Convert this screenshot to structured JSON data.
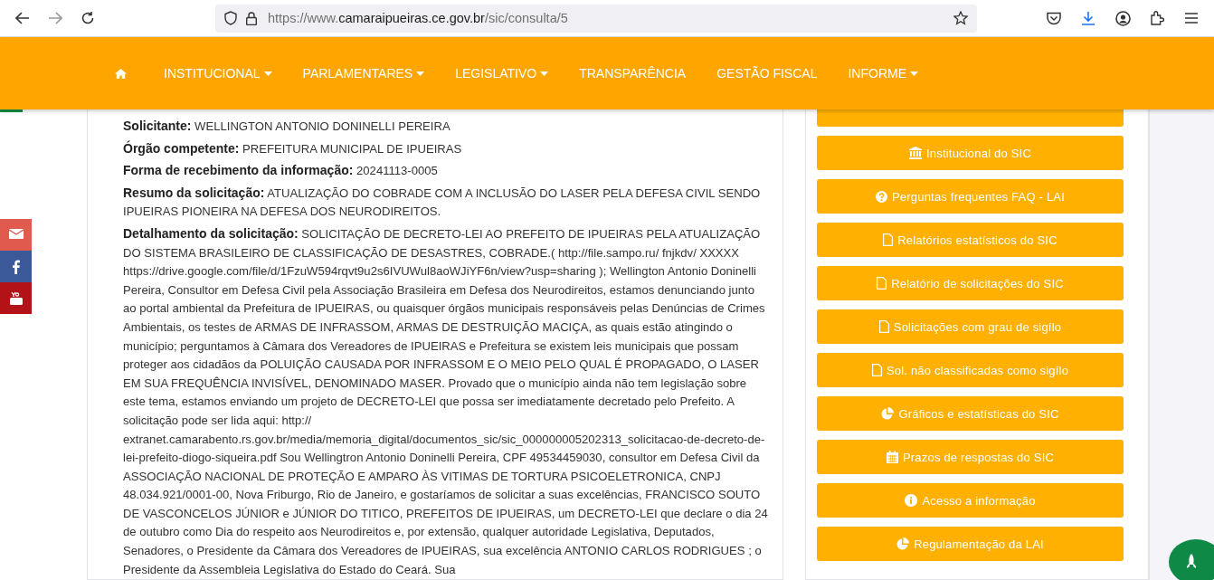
{
  "browser": {
    "url_prefix": "https://www.",
    "url_domain": "camaraipueiras.ce.gov.br",
    "url_path": "/sic/consulta/5"
  },
  "nav": {
    "items": [
      {
        "label": "INSTITUCIONAL",
        "has_menu": true
      },
      {
        "label": "PARLAMENTARES",
        "has_menu": true
      },
      {
        "label": "LEGISLATIVO",
        "has_menu": true
      },
      {
        "label": "TRANSPARÊNCIA",
        "has_menu": false
      },
      {
        "label": "GESTÃO FISCAL",
        "has_menu": false
      },
      {
        "label": "INFORME",
        "has_menu": true
      }
    ]
  },
  "request": {
    "fields": [
      "**Solicitante:** WELLINGTON ANTONIO DONINELLI PEREIRA",
      "**Órgão competente:** PREFEITURA MUNICIPAL DE IPUEIRAS",
      "**Forma de recebimento da informação:** 20241113-0005",
      "**Resumo da solicitação:** ATUALIZAÇÃO DO COBRADE COM A INCLUSÃO DO LASER PELA DEFESA CIVIL SENDO IPUEIRAS PIONEIRA NA DEFESA DOS NEURODIREITOS.",
      "**Detalhamento da solicitação:** SOLICITAÇÃO DE DECRETO-LEI AO PREFEITO DE IPUEIRAS PELA ATUALIZAÇÃO DO SISTEMA BRASILEIRO DE CLASSIFICAÇÃO DE DESASTRES, COBRADE.( http://file.sampo.ru/ fnjkdv/ XXXXX https://drive.google.com/file/d/1FzuW594rqvt9u2s6IVUWul8aoWJiYF6n/view?usp=sharing ); Wellington Antonio Doninelli Pereira, Consultor em Defesa Civil pela Associação Brasileira em Defesa dos Neurodireitos, estamos denunciando junto ao portal ambiental da Prefeitura de IPUEIRAS, ou quaisquer órgãos municipais responsáveis pelas Denúncias de Crimes Ambientais, os testes de ARMAS DE INFRASSOM, ARMAS DE DESTRUIÇÃO MACIÇA, as quais estão atingindo o município; perguntamos à Câmara dos Vereadores de IPUEIRAS e Prefeitura se existem leis municipais que possam proteger aos cidadãos da POLUIÇÃO CAUSADA POR INFRASSOM E O MEIO PELO QUAL É PROPAGADO, O LASER EM SUA FREQUÊNCIA INVISÍVEL, DENOMINADO MASER. Provado que o município ainda não tem legislação sobre este tema, estamos enviando um projeto de DECRETO-LEI que possa ser imediatamente decretado pelo Prefeito. A solicitação pode ser lida aqui: http:// extranet.camarabento.rs.gov.br/media/memoria_digital/documentos_sic/sic_000000005202313_solicitacao-de-decreto-de-lei-prefeito-diogo-siqueira.pdf Sou Wellingtron Antonio Doninelli Pereira, CPF 49534459030, consultor em Defesa Civil da ASSOCIAÇÃO NACIONAL DE PROTEÇÃO E AMPARO ÀS VITIMAS DE TORTURA PSICOELETRONICA, CNPJ 48.034.921/0001-00, Nova Friburgo, Rio de Janeiro, e gostaríamos de solicitar a suas excelências, FRANCISCO SOUTO DE VASCONCELOS JÚNIOR e JÚNIOR DO TITICO, PREFEITOS DE IPUEIRAS, um DECRETO-LEI que declare o dia 24 de outubro como Dia do respeito aos Neurodireitos e, por extensão, qualquer autoridade Legislativa, Deputados, Senadores, o Presidente da Câmara dos Vereadores de IPUEIRAS, sua excelência ANTONIO CARLOS RODRIGUES ; o Presidente da Assembleia Legislativa do Estado do Ceará. Sua"
    ]
  },
  "sidebar": {
    "buttons": [
      {
        "kind": "bank",
        "label": "Institucional do SIC"
      },
      {
        "kind": "question",
        "label": "Perguntas frequentes FAQ - LAI"
      },
      {
        "kind": "file",
        "label": "Relatórios estatísticos do SIC"
      },
      {
        "kind": "file",
        "label": "Relatório de solicitações do SIC"
      },
      {
        "kind": "file",
        "label": "Solicitações com grau de sigílo"
      },
      {
        "kind": "file",
        "label": "Sol. não classificadas como sigílo"
      },
      {
        "kind": "pie",
        "label": "Gráficos e estatísticas do SIC"
      },
      {
        "kind": "calendar",
        "label": "Prazos de respostas do SIC"
      },
      {
        "kind": "info",
        "label": "Acesso a informação"
      },
      {
        "kind": "pie",
        "label": "Regulamentação da LAI"
      }
    ]
  },
  "social": [
    {
      "kind": "email",
      "color": "#e05a4e"
    },
    {
      "kind": "facebook",
      "color": "#3b5998"
    },
    {
      "kind": "youtube",
      "color": "#b31217"
    }
  ]
}
